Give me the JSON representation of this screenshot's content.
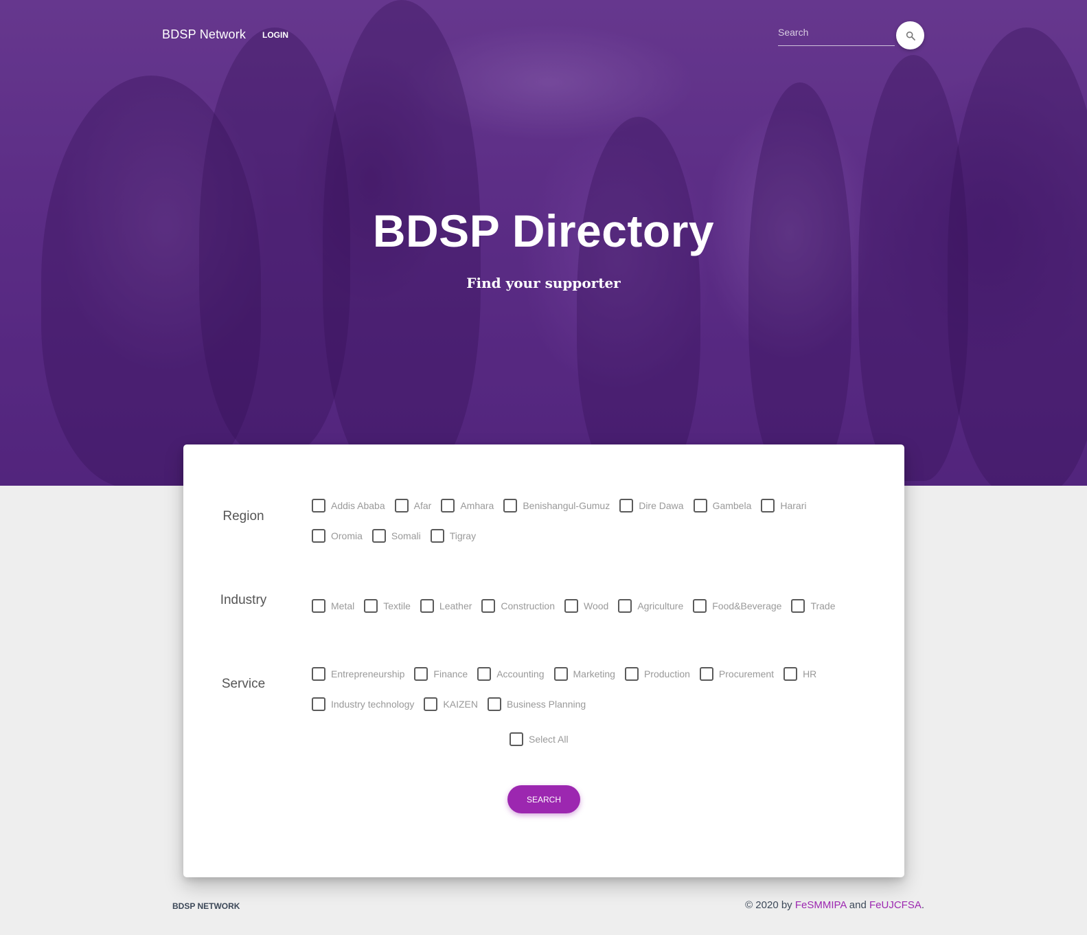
{
  "nav": {
    "brand": "BDSP Network",
    "login": "LOGIN",
    "search_placeholder": "Search"
  },
  "hero": {
    "title": "BDSP Directory",
    "subtitle": "Find your supporter"
  },
  "filters": {
    "region": {
      "label": "Region",
      "options": [
        "Addis Ababa",
        "Afar",
        "Amhara",
        "Benishangul-Gumuz",
        "Dire Dawa",
        "Gambela",
        "Harari",
        "Oromia",
        "Somali",
        "Tigray"
      ]
    },
    "industry": {
      "label": "Industry",
      "options": [
        "Metal",
        "Textile",
        "Leather",
        "Construction",
        "Wood",
        "Agriculture",
        "Food&Beverage",
        "Trade"
      ]
    },
    "service": {
      "label": "Service",
      "options": [
        "Entrepreneurship",
        "Finance",
        "Accounting",
        "Marketing",
        "Production",
        "Procurement",
        "HR",
        "Industry technology",
        "KAIZEN",
        "Business Planning"
      ]
    },
    "select_all": "Select All",
    "search_button": "SEARCH"
  },
  "footer": {
    "brand": "BDSP NETWORK",
    "copy_prefix": "© 2020 by",
    "org1": "FeSMMIPA",
    "and": "and",
    "org2": "FeUJCFSA",
    "period": "."
  },
  "colors": {
    "accent": "#9c27b0",
    "hero_overlay": "#5b2e83",
    "background": "#eeeeee"
  },
  "icons": {
    "search": "search-icon"
  }
}
